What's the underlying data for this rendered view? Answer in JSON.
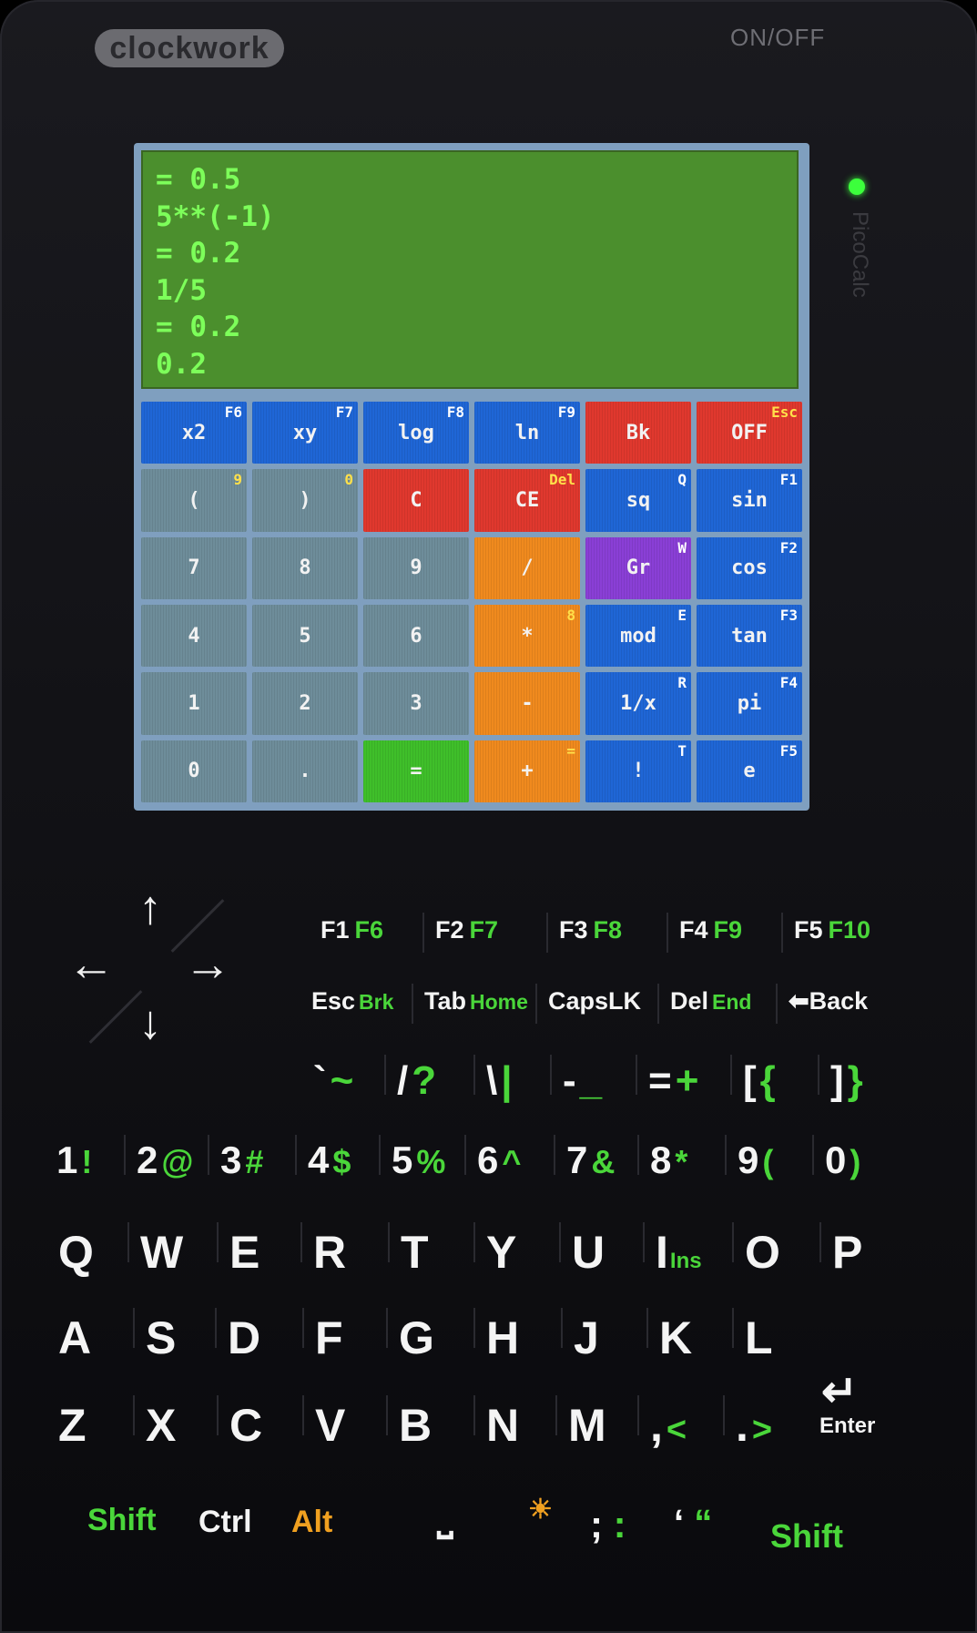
{
  "device": {
    "brand": "clockwork",
    "power_label": "ON/OFF",
    "model": "PicoCalc",
    "led_color": "#3cff3c"
  },
  "screen": {
    "background": "#4b8f2d",
    "text_color": "#7dff5a",
    "lines": [
      "= 0.5",
      "5**(-1)",
      "= 0.2",
      "1/5",
      "= 0.2",
      "0.2"
    ]
  },
  "calc_keys": [
    {
      "label": "x2",
      "fn": "F6",
      "color": "blue"
    },
    {
      "label": "xy",
      "fn": "F7",
      "color": "blue"
    },
    {
      "label": "log",
      "fn": "F8",
      "color": "blue"
    },
    {
      "label": "ln",
      "fn": "F9",
      "color": "blue"
    },
    {
      "label": "Bk",
      "fn": "",
      "color": "red"
    },
    {
      "label": "OFF",
      "fn": "Esc",
      "color": "red",
      "fn_yellow": true
    },
    {
      "label": "(",
      "fn": "9",
      "color": "gray",
      "fn_yellow": true
    },
    {
      "label": ")",
      "fn": "0",
      "color": "gray",
      "fn_yellow": true
    },
    {
      "label": "C",
      "fn": "",
      "color": "red"
    },
    {
      "label": "CE",
      "fn": "Del",
      "color": "red",
      "fn_yellow": true
    },
    {
      "label": "sq",
      "fn": "Q",
      "color": "blue"
    },
    {
      "label": "sin",
      "fn": "F1",
      "color": "blue"
    },
    {
      "label": "7",
      "fn": "",
      "color": "gray"
    },
    {
      "label": "8",
      "fn": "",
      "color": "gray"
    },
    {
      "label": "9",
      "fn": "",
      "color": "gray"
    },
    {
      "label": "/",
      "fn": "",
      "color": "orange"
    },
    {
      "label": "Gr",
      "fn": "W",
      "color": "purple"
    },
    {
      "label": "cos",
      "fn": "F2",
      "color": "blue"
    },
    {
      "label": "4",
      "fn": "",
      "color": "gray"
    },
    {
      "label": "5",
      "fn": "",
      "color": "gray"
    },
    {
      "label": "6",
      "fn": "",
      "color": "gray"
    },
    {
      "label": "*",
      "fn": "8",
      "color": "orange",
      "fn_yellow": true
    },
    {
      "label": "mod",
      "fn": "E",
      "color": "blue"
    },
    {
      "label": "tan",
      "fn": "F3",
      "color": "blue"
    },
    {
      "label": "1",
      "fn": "",
      "color": "gray"
    },
    {
      "label": "2",
      "fn": "",
      "color": "gray"
    },
    {
      "label": "3",
      "fn": "",
      "color": "gray"
    },
    {
      "label": "-",
      "fn": "",
      "color": "orange"
    },
    {
      "label": "1/x",
      "fn": "R",
      "color": "blue"
    },
    {
      "label": "pi",
      "fn": "F4",
      "color": "blue"
    },
    {
      "label": "0",
      "fn": "",
      "color": "gray"
    },
    {
      "label": ".",
      "fn": "",
      "color": "gray"
    },
    {
      "label": "=",
      "fn": "",
      "color": "green"
    },
    {
      "label": "+",
      "fn": "=",
      "color": "orange",
      "fn_yellow": true
    },
    {
      "label": "!",
      "fn": "T",
      "color": "blue"
    },
    {
      "label": "e",
      "fn": "F5",
      "color": "blue"
    }
  ],
  "fkeys": [
    {
      "main": "F1",
      "alt": "F6"
    },
    {
      "main": "F2",
      "alt": "F7"
    },
    {
      "main": "F3",
      "alt": "F8"
    },
    {
      "main": "F4",
      "alt": "F9"
    },
    {
      "main": "F5",
      "alt": "F10"
    }
  ],
  "navkeys": [
    {
      "main": "Esc",
      "alt": "Brk"
    },
    {
      "main": "Tab",
      "alt": "Home"
    },
    {
      "main": "CapsLK",
      "alt": ""
    },
    {
      "main": "Del",
      "alt": "End"
    },
    {
      "main": "⬅Back",
      "alt": ""
    }
  ],
  "symkeys": [
    {
      "main": "`",
      "alt": "~"
    },
    {
      "main": "/",
      "alt": "?"
    },
    {
      "main": "\\",
      "alt": "|"
    },
    {
      "main": "-",
      "alt": "_"
    },
    {
      "main": "=",
      "alt": "+"
    },
    {
      "main": "[",
      "alt": "{"
    },
    {
      "main": "]",
      "alt": "}"
    }
  ],
  "numkeys": [
    {
      "main": "1",
      "alt": "!"
    },
    {
      "main": "2",
      "alt": "@"
    },
    {
      "main": "3",
      "alt": "#"
    },
    {
      "main": "4",
      "alt": "$"
    },
    {
      "main": "5",
      "alt": "%"
    },
    {
      "main": "6",
      "alt": "^"
    },
    {
      "main": "7",
      "alt": "&"
    },
    {
      "main": "8",
      "alt": "*"
    },
    {
      "main": "9",
      "alt": "("
    },
    {
      "main": "0",
      "alt": ")"
    }
  ],
  "row_q": [
    {
      "main": "Q",
      "alt": ""
    },
    {
      "main": "W",
      "alt": ""
    },
    {
      "main": "E",
      "alt": ""
    },
    {
      "main": "R",
      "alt": ""
    },
    {
      "main": "T",
      "alt": ""
    },
    {
      "main": "Y",
      "alt": ""
    },
    {
      "main": "U",
      "alt": ""
    },
    {
      "main": "I",
      "alt": "Ins"
    },
    {
      "main": "O",
      "alt": ""
    },
    {
      "main": "P",
      "alt": ""
    }
  ],
  "row_a": [
    {
      "main": "A",
      "alt": ""
    },
    {
      "main": "S",
      "alt": ""
    },
    {
      "main": "D",
      "alt": ""
    },
    {
      "main": "F",
      "alt": ""
    },
    {
      "main": "G",
      "alt": ""
    },
    {
      "main": "H",
      "alt": ""
    },
    {
      "main": "J",
      "alt": ""
    },
    {
      "main": "K",
      "alt": ""
    },
    {
      "main": "L",
      "alt": ""
    }
  ],
  "row_z": [
    {
      "main": "Z",
      "alt": ""
    },
    {
      "main": "X",
      "alt": ""
    },
    {
      "main": "C",
      "alt": ""
    },
    {
      "main": "V",
      "alt": ""
    },
    {
      "main": "B",
      "alt": ""
    },
    {
      "main": "N",
      "alt": ""
    },
    {
      "main": "M",
      "alt": ""
    },
    {
      "main": ",",
      "alt": "<"
    },
    {
      "main": ".",
      "alt": ">"
    }
  ],
  "enter_label": "Enter",
  "enter_icon": "↵",
  "bottom": {
    "shift_left": "Shift",
    "ctrl": "Ctrl",
    "alt": "Alt",
    "space_icon": "⎵",
    "semicolon": ";",
    "colon": ":",
    "quote": "‘",
    "dquote": "“",
    "shift_right": "Shift"
  }
}
